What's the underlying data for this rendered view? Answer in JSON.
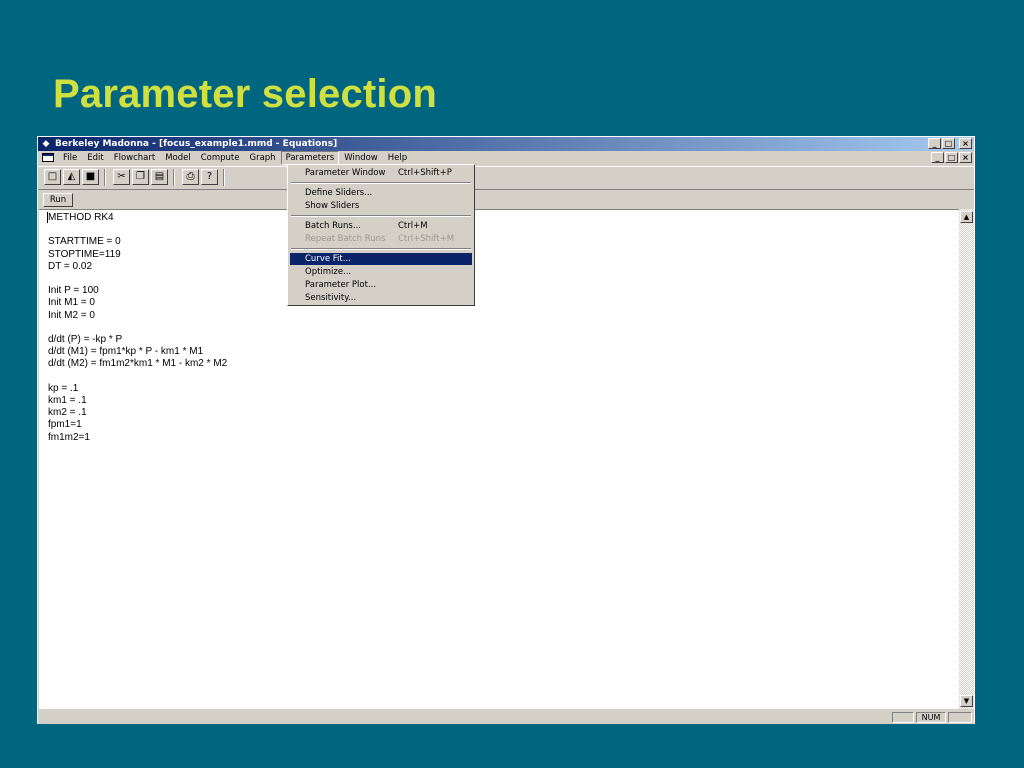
{
  "slide": {
    "title": "Parameter selection"
  },
  "window": {
    "title": "Berkeley Madonna - [focus_example1.mmd - Equations]",
    "icons": {
      "app": "diamond-app-icon",
      "doc": "document-icon"
    }
  },
  "menubar": {
    "items": [
      "File",
      "Edit",
      "Flowchart",
      "Model",
      "Compute",
      "Graph",
      "Parameters",
      "Window",
      "Help"
    ],
    "open_item": "Parameters"
  },
  "toolbar": {
    "icons": [
      "new-icon",
      "open-icon",
      "save-icon",
      "cut-icon",
      "copy-icon",
      "paste-icon",
      "print-icon",
      "help-icon"
    ]
  },
  "run_button": {
    "label": "Run"
  },
  "editor": {
    "lines": [
      "METHOD RK4",
      "",
      "STARTTIME = 0",
      "STOPTIME=119",
      "DT = 0.02",
      "",
      "Init P = 100",
      "Init M1 = 0",
      "Init M2 = 0",
      "",
      "d/dt (P) = -kp * P",
      "d/dt (M1) = fpm1*kp * P - km1 * M1",
      "d/dt (M2) = fm1m2*km1 * M1 - km2 * M2",
      "",
      "kp = .1",
      "km1 = .1",
      "km2 = .1",
      "fpm1=1",
      "fm1m2=1"
    ]
  },
  "dropdown": {
    "groups": [
      [
        {
          "label": "Parameter Window",
          "shortcut": "Ctrl+Shift+P"
        }
      ],
      [
        {
          "label": "Define Sliders...",
          "shortcut": ""
        },
        {
          "label": "Show Sliders",
          "shortcut": ""
        }
      ],
      [
        {
          "label": "Batch Runs...",
          "shortcut": "Ctrl+M"
        },
        {
          "label": "Repeat Batch Runs",
          "shortcut": "Ctrl+Shift+M",
          "disabled": true
        }
      ],
      [
        {
          "label": "Curve Fit...",
          "shortcut": "",
          "highlighted": true
        },
        {
          "label": "Optimize...",
          "shortcut": ""
        },
        {
          "label": "Parameter Plot...",
          "shortcut": ""
        },
        {
          "label": "Sensitivity...",
          "shortcut": ""
        }
      ]
    ]
  },
  "statusbar": {
    "num_indicator": "NUM"
  },
  "colors": {
    "background": "#006680",
    "title": "#cfe040",
    "titlebar": "#0a246a",
    "highlight": "#0a246a"
  }
}
